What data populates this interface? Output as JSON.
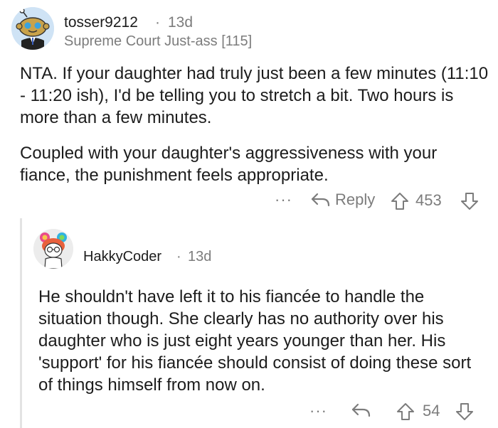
{
  "comment": {
    "username": "tosser9212",
    "separator": "·",
    "age": "13d",
    "flair": "Supreme Court Just-ass [115]",
    "paragraphs": [
      "NTA. If your daughter had truly just been a few minutes (11:10 - 11:20 ish), I'd be telling you to stretch a bit. Two hours is more than a few minutes.",
      "Coupled with your daughter's aggressiveness with your fiance, the punishment feels appropriate."
    ],
    "actions": {
      "more": "···",
      "reply_label": "Reply",
      "score": "453"
    }
  },
  "reply": {
    "username": "HakkyCoder",
    "separator": "·",
    "age": "13d",
    "paragraphs": [
      "He shouldn't have left it to his fiancée to handle the situation though. She clearly has no authority over his daughter who is just eight years younger than her. His 'support' for his fiancée should consist of doing these sort of things himself from now on."
    ],
    "actions": {
      "more": "···",
      "score": "54"
    }
  },
  "colors": {
    "text": "#1c1c1c",
    "meta": "#7c7c7c",
    "thread_line": "#e3e3e3"
  },
  "icons": {
    "more": "more-options-icon",
    "reply": "reply-arrow-icon",
    "upvote": "upvote-arrow-icon",
    "downvote": "downvote-arrow-icon"
  }
}
